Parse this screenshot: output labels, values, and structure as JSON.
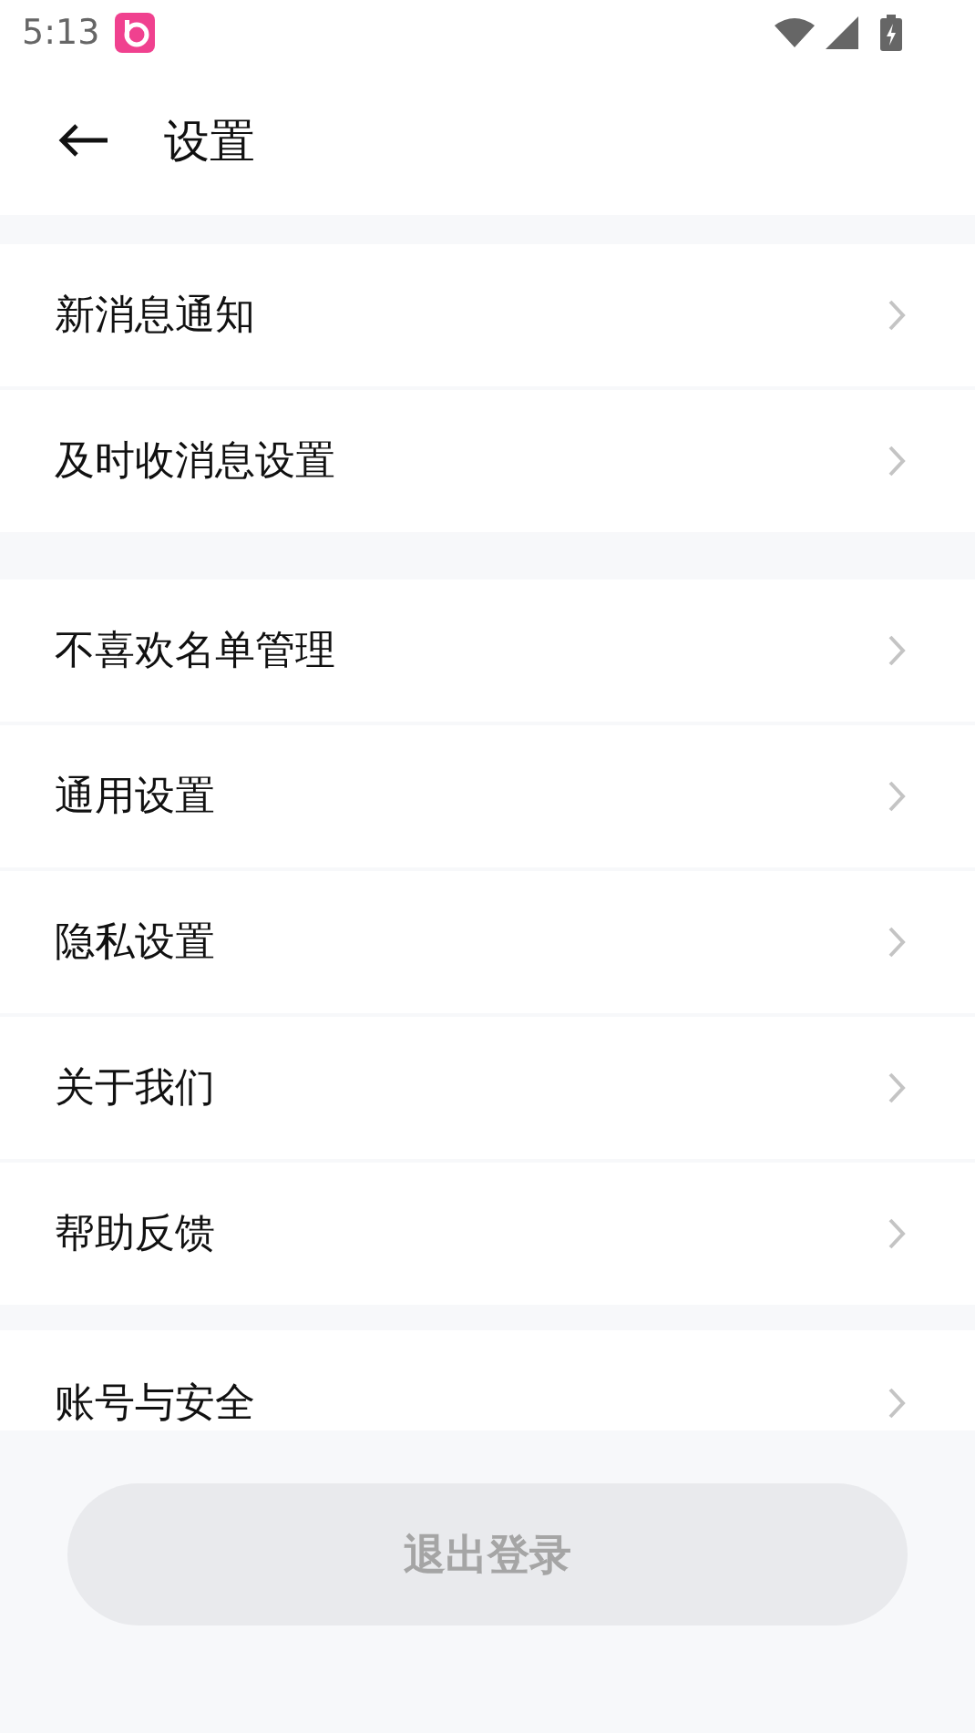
{
  "status_bar": {
    "time": "5:13"
  },
  "header": {
    "title": "设置"
  },
  "groups": [
    {
      "items": [
        {
          "label": "新消息通知"
        },
        {
          "label": "及时收消息设置"
        }
      ]
    },
    {
      "items": [
        {
          "label": "不喜欢名单管理"
        },
        {
          "label": "通用设置"
        },
        {
          "label": "隐私设置"
        },
        {
          "label": "关于我们"
        },
        {
          "label": "帮助反馈"
        }
      ]
    },
    {
      "items": [
        {
          "label": "账号与安全"
        }
      ]
    }
  ],
  "logout_button": {
    "label": "退出登录",
    "disabled": true
  }
}
